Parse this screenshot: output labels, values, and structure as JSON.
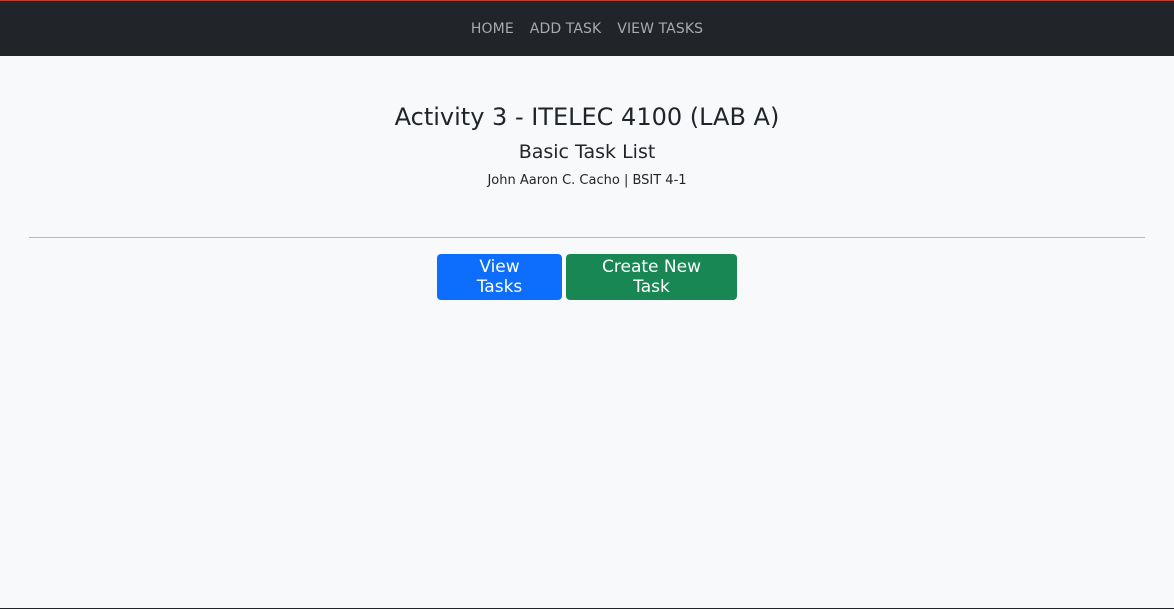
{
  "nav": {
    "items": [
      {
        "label": "HOME"
      },
      {
        "label": "ADD TASK"
      },
      {
        "label": "VIEW TASKS"
      }
    ]
  },
  "header": {
    "title": "Activity 3 - ITELEC 4100 (LAB A)",
    "subtitle": "Basic Task List",
    "author": "John Aaron C. Cacho | BSIT 4-1"
  },
  "actions": {
    "view_tasks_label": "View Tasks",
    "create_task_label": "Create New Task"
  },
  "colors": {
    "navbar_bg": "#212529",
    "primary": "#0d6efd",
    "success": "#198754",
    "page_bg": "#f8f9fa"
  }
}
